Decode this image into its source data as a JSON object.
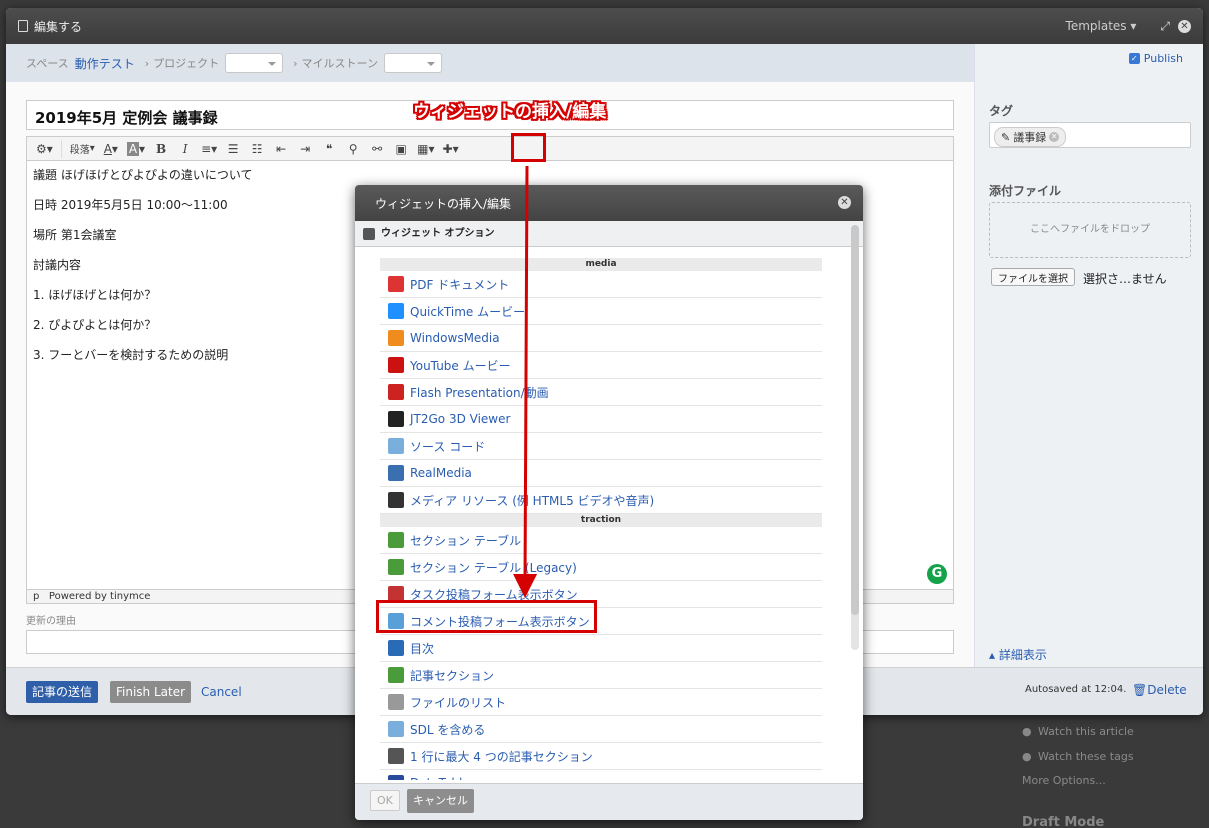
{
  "window": {
    "title": "編集する",
    "templates_label": "Templates ▾"
  },
  "breadcrumb": {
    "space_label": "スペース",
    "space_value": "動作テスト",
    "project_label": "プロジェクト",
    "milestone_label": "マイルストーン"
  },
  "publish": {
    "label": "Publish"
  },
  "article": {
    "title": "2019年5月 定例会 議事録",
    "body": [
      "議題 ほげほげとぴよぴよの違いについて",
      "日時 2019年5月5日 10:00〜11:00",
      "場所 第1会議室",
      "討議内容",
      "1. ほげほげとは何か？",
      "2. ぴよぴよとは何か？",
      "3. フーとバーを検討するための説明"
    ]
  },
  "toolbar": {
    "paragraph_label": "段落"
  },
  "status_bar": {
    "path": "p",
    "powered": "Powered by tinymce"
  },
  "reason": {
    "label": "更新の理由"
  },
  "sidebar": {
    "tags_heading": "タグ",
    "tag": "議事録",
    "attachments_heading": "添付ファイル",
    "drop_text": "ここへファイルをドロップ",
    "file_button": "ファイルを選択",
    "file_status": "選択さ…ません",
    "detail_link": "詳細表示"
  },
  "footer": {
    "submit": "記事の送信",
    "finish_later": "Finish Later",
    "cancel": "Cancel",
    "autosave": "Autosaved at 12:04.",
    "delete": "Delete"
  },
  "background": {
    "watch_article": "Watch this article",
    "watch_tags": "Watch these tags",
    "more_options": "More Options...",
    "draft_mode": "Draft Mode"
  },
  "annotation": {
    "label": "ウィジェットの挿入/編集"
  },
  "modal": {
    "title": "ウィジェットの挿入/編集",
    "subtitle": "ウィジェット オプション",
    "sections": [
      {
        "heading": "media",
        "items": [
          {
            "label": "PDF ドキュメント",
            "icon": "pdf-icon",
            "color": "#d33"
          },
          {
            "label": "QuickTime ムービー",
            "icon": "quicktime-icon",
            "color": "#1e90ff"
          },
          {
            "label": "WindowsMedia",
            "icon": "windows-media-icon",
            "color": "#f08c1e"
          },
          {
            "label": "YouTube ムービー",
            "icon": "youtube-icon",
            "color": "#cc1111"
          },
          {
            "label": "Flash Presentation/動画",
            "icon": "flash-icon",
            "color": "#cc2222"
          },
          {
            "label": "JT2Go 3D Viewer",
            "icon": "jt2go-icon",
            "color": "#222222"
          },
          {
            "label": "ソース コード",
            "icon": "source-code-icon",
            "color": "#7aaedc"
          },
          {
            "label": "RealMedia",
            "icon": "realmedia-icon",
            "color": "#3a6fb0"
          },
          {
            "label": "メディア リソース (例 HTML5 ビデオや音声)",
            "icon": "film-icon",
            "color": "#333333"
          }
        ]
      },
      {
        "heading": "traction",
        "items": [
          {
            "label": "セクション テーブル",
            "icon": "section-table-icon",
            "color": "#4a9b3a"
          },
          {
            "label": "セクション テーブル (Legacy)",
            "icon": "section-table-legacy-icon",
            "color": "#4a9b3a"
          },
          {
            "label": "タスク投稿フォーム表示ボタン",
            "icon": "task-form-icon",
            "color": "#c33333"
          },
          {
            "label": "コメント投稿フォーム表示ボタン",
            "icon": "comment-form-icon",
            "color": "#5aa0d8"
          },
          {
            "label": "目次",
            "icon": "anchor-icon",
            "color": "#2a6bb5"
          },
          {
            "label": "記事セクション",
            "icon": "article-section-icon",
            "color": "#4a9b3a"
          },
          {
            "label": "ファイルのリスト",
            "icon": "file-list-icon",
            "color": "#999999"
          },
          {
            "label": "SDL を含める",
            "icon": "sdl-icon",
            "color": "#7aaedc"
          },
          {
            "label": "1 行に最大 4 つの記事セクション",
            "icon": "four-sections-icon",
            "color": "#555555"
          },
          {
            "label": "DataTables",
            "icon": "datatables-icon",
            "color": "#2a4b9b"
          }
        ]
      }
    ],
    "ok": "OK",
    "cancel": "キャンセル"
  }
}
